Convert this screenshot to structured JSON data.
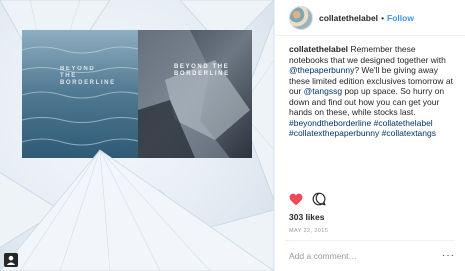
{
  "post": {
    "username": "collatethelabel",
    "separator": "•",
    "follow_label": "Follow",
    "caption_author": "collatethelabel",
    "caption_text_1": "Remember these notebooks that we designed together with",
    "mention_1": "@thepaperbunny",
    "caption_text_2": "? We'll be giving away these limited edition exclusives tomorrow at our",
    "mention_2": "@tangssg",
    "caption_text_3": "pop up space. So hurry on down and find out how you can get your hands on these, while stocks last.",
    "hashtag_1": "#beyondtheborderline",
    "hashtag_2": "#collatethelabel",
    "hashtag_3": "#collatexthepaperbunny",
    "hashtag_4": "#collatextangs",
    "likes": "303 likes",
    "date": "MAY 22, 2015",
    "comment_placeholder": "Add a comment…",
    "more_label": "···"
  },
  "photo": {
    "left_notebook_title": "BEYOND THE BORDERLINE",
    "right_notebook_title": "BEYOND THE BORDERLINE"
  },
  "icons": {
    "like": "heart-icon",
    "comment": "comment-bubble-icon",
    "user_tag": "user-tag-icon",
    "more": "more-options-icon"
  },
  "colors": {
    "like_red": "#ed4956",
    "link_blue": "#003569",
    "follow_blue": "#3897f0"
  }
}
